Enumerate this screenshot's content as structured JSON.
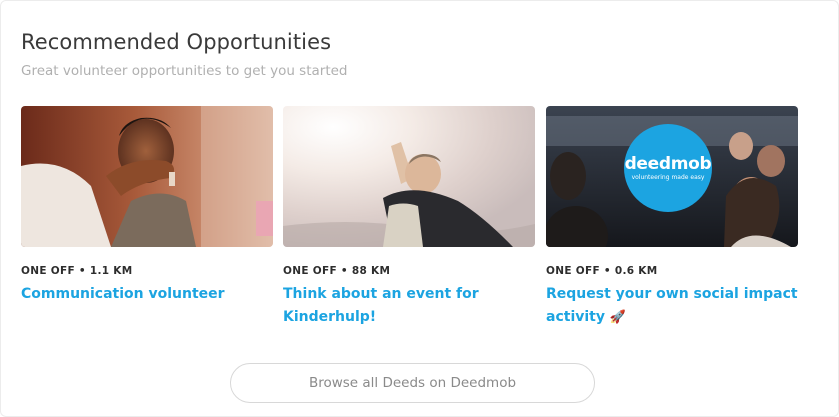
{
  "section": {
    "title": "Recommended Opportunities",
    "subtitle": "Great volunteer opportunities to get you started"
  },
  "cards": [
    {
      "meta": "ONE OFF • 1.1 KM",
      "title": "Communication volunteer",
      "image": "boy-waving-photo"
    },
    {
      "meta": "ONE OFF • 88 KM",
      "title": "Think about an event for Kinderhulp!",
      "image": "superhero-child-photo"
    },
    {
      "meta": "ONE OFF • 0.6 KM",
      "title": "Request your own social impact activity",
      "title_emoji": "🚀",
      "image": "crowd-deedmob-photo",
      "logo": {
        "brand": "deedmob",
        "tagline": "volunteering made easy",
        "color": "#1ca4e1"
      }
    }
  ],
  "browse_button": {
    "label": "Browse all Deeds on Deedmob"
  },
  "colors": {
    "accent": "#1ca4e1",
    "heading": "#3a3a3a",
    "subtitle": "#b0b0b0"
  }
}
